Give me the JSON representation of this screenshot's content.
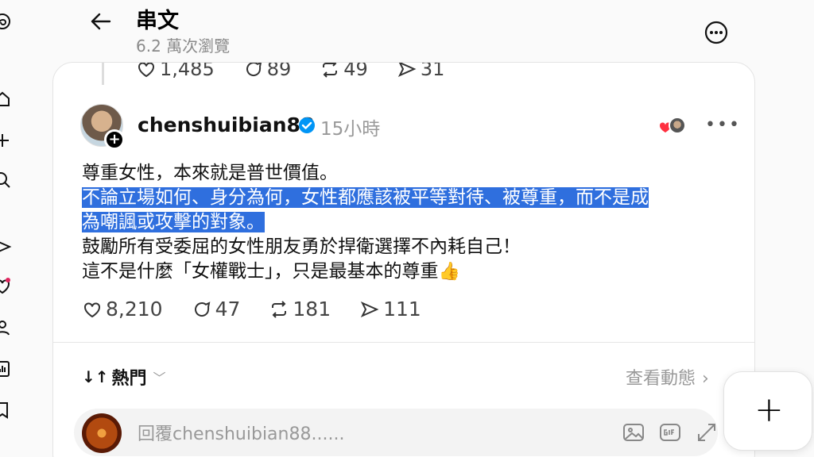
{
  "header": {
    "title": "串文",
    "views": "6.2 萬次瀏覽"
  },
  "previous_post": {
    "likes": "1,485",
    "comments": "89",
    "reposts": "49",
    "shares": "31"
  },
  "post": {
    "username": "chenshuibian88",
    "time": "15小時",
    "lines": [
      "尊重女性，本來就是普世價值。",
      "不論立場如何、身分為何，女性都應該被平等對待、被尊重，而不是成",
      "為嘲諷或攻擊的對象。",
      "鼓勵所有受委屈的女性朋友勇於捍衛選擇不內耗自己！",
      "這不是什麼「女權戰士」，只是最基本的尊重"
    ],
    "emoji": "👍",
    "likes": "8,210",
    "comments": "47",
    "reposts": "181",
    "shares": "111"
  },
  "sort": {
    "label": "熱門",
    "arrows": "↓↑"
  },
  "activity_link": "查看動態",
  "reply": {
    "placeholder": "回覆chenshuibian88......"
  },
  "icons": {
    "rail": [
      "threads-logo-icon",
      "home-icon",
      "plus-icon",
      "search-icon",
      "send-icon",
      "heart-icon",
      "profile-icon",
      "insights-icon",
      "bookmark-icon"
    ],
    "highlight_color": "#2f6fde",
    "verified_color": "#0095f6"
  }
}
